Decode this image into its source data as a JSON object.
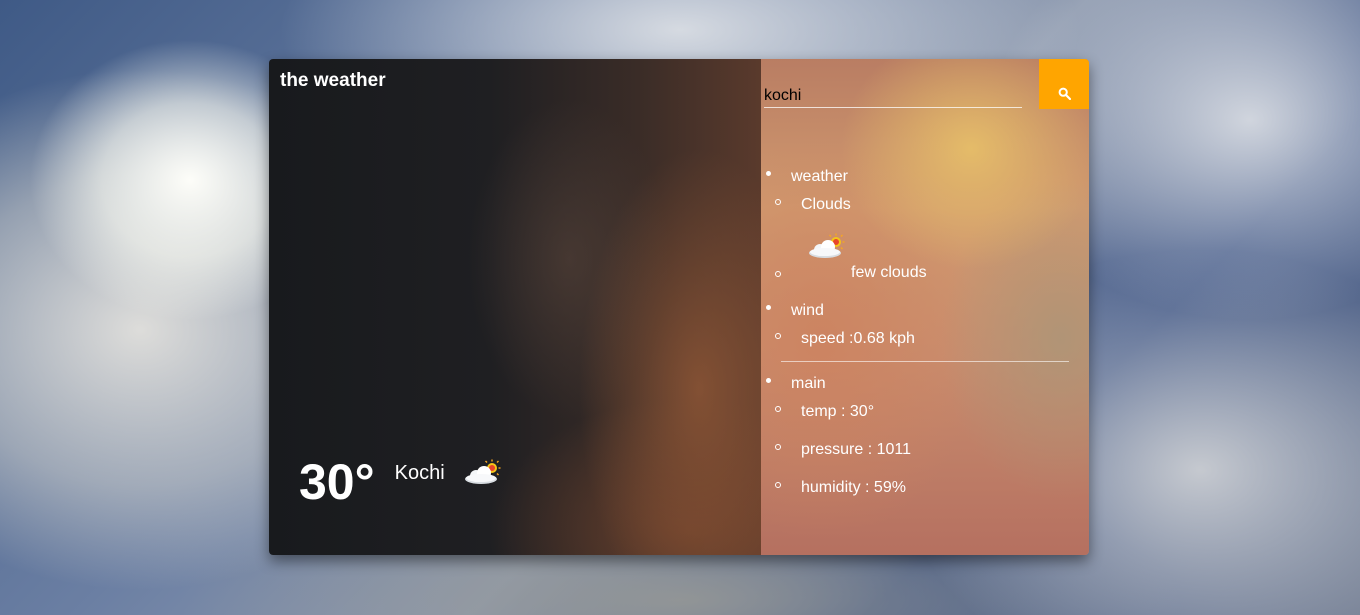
{
  "app": {
    "title": "the weather"
  },
  "current": {
    "temperature": "30°",
    "city": "Kochi",
    "icon": "few-clouds-icon"
  },
  "search": {
    "value": "kochi",
    "button_icon": "search-icon",
    "button_color": "#ffa500"
  },
  "details": {
    "weather": {
      "label": "weather",
      "main": "Clouds",
      "icon": "few-clouds-icon",
      "description": "few clouds"
    },
    "wind": {
      "label": "wind",
      "speed": "speed :0.68 kph"
    },
    "main": {
      "label": "main",
      "temp": "temp : 30°",
      "pressure": "pressure : 1011",
      "humidity": "humidity : 59%"
    }
  }
}
